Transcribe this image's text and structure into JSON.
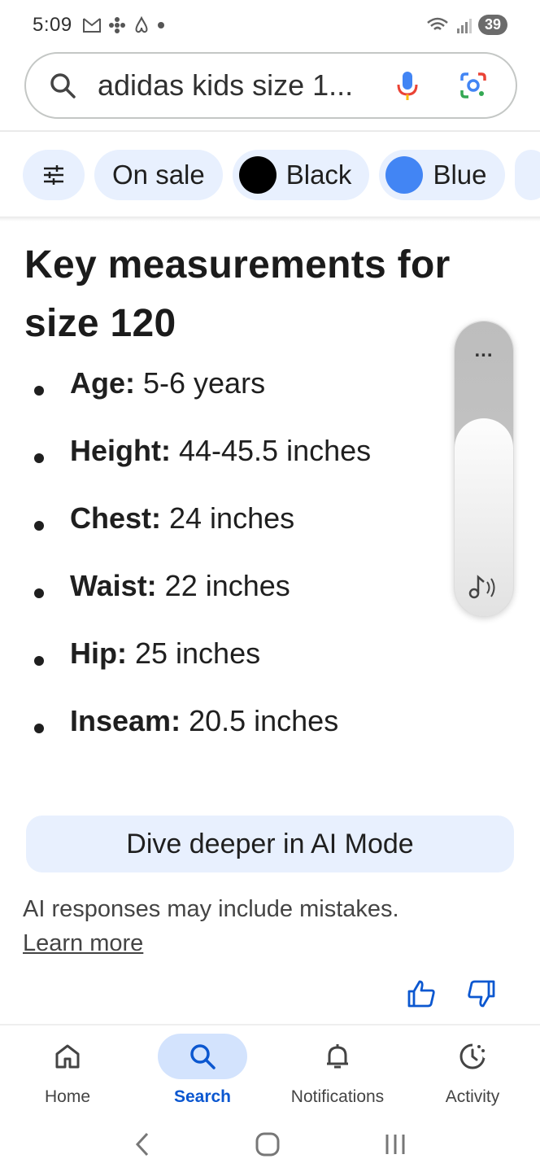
{
  "status_bar": {
    "time": "5:09",
    "battery": "39"
  },
  "search": {
    "query": "adidas kids size 1..."
  },
  "filters": {
    "chips": [
      {
        "label": "On sale"
      },
      {
        "label": "Black",
        "color": "#000000"
      },
      {
        "label": "Blue",
        "color": "#4285f4"
      }
    ]
  },
  "overview": {
    "heading": "Key measurements for size 120",
    "measurements": [
      {
        "label": "Age:",
        "value": "5-6 years"
      },
      {
        "label": "Height:",
        "value": "44-45.5 inches"
      },
      {
        "label": "Chest:",
        "value": "24 inches"
      },
      {
        "label": "Waist:",
        "value": "22 inches"
      },
      {
        "label": "Hip:",
        "value": "25 inches"
      },
      {
        "label": "Inseam:",
        "value": "20.5 inches"
      }
    ]
  },
  "volume_overlay": {
    "more": "...",
    "level": 0.67
  },
  "ai": {
    "button": "Dive deeper in AI Mode",
    "disclaimer": "AI responses may include mistakes.",
    "learn_more": "Learn more"
  },
  "bottom_nav": {
    "items": [
      {
        "label": "Home"
      },
      {
        "label": "Search"
      },
      {
        "label": "Notifications"
      },
      {
        "label": "Activity"
      }
    ],
    "active": "Search"
  },
  "colors": {
    "accent": "#0b57d0",
    "chip_bg": "#e8f0fe"
  }
}
